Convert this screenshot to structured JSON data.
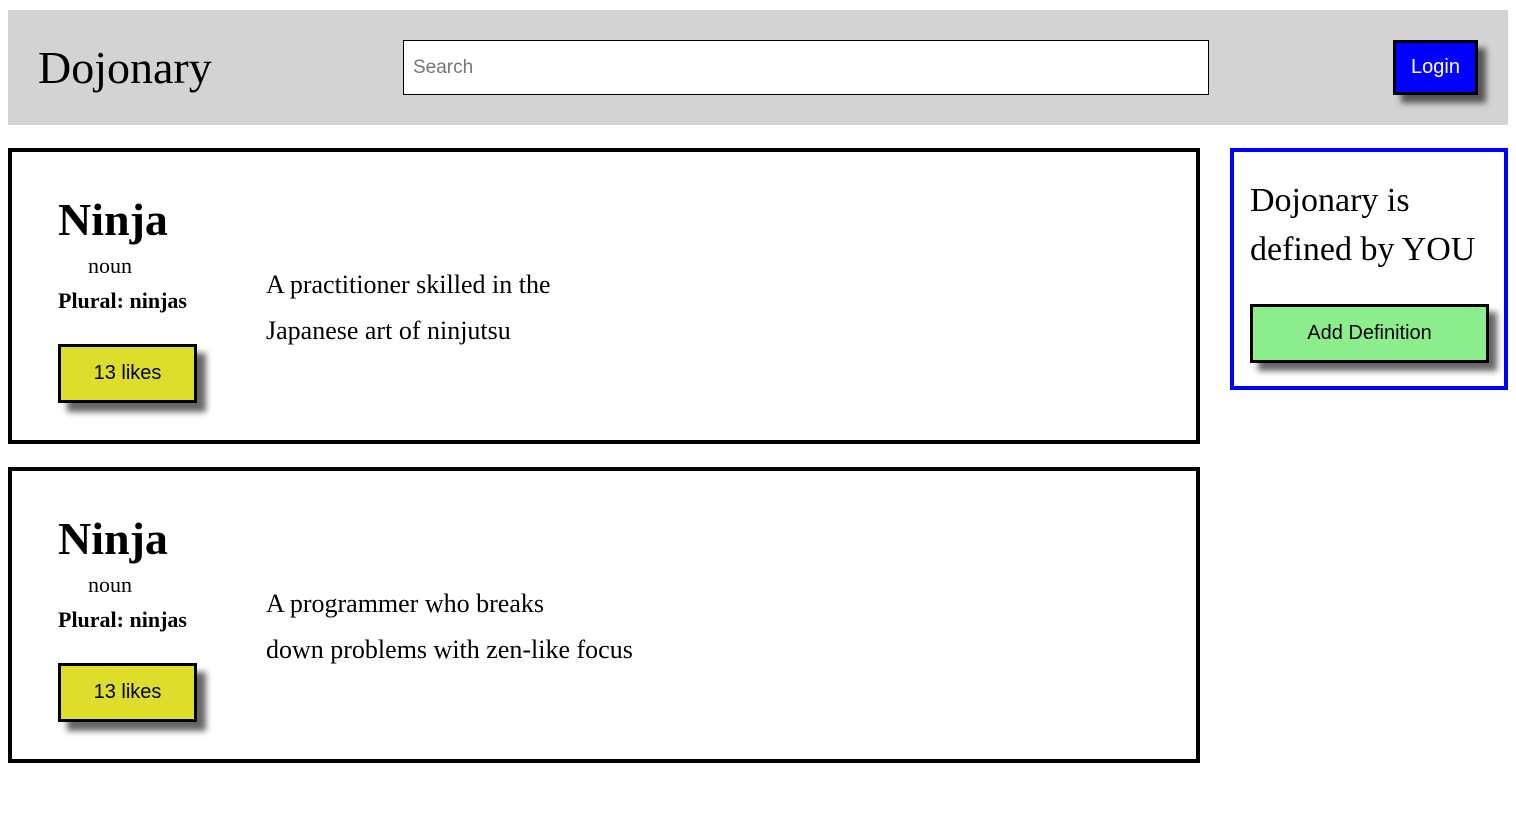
{
  "header": {
    "brand": "Dojonary",
    "search_placeholder": "Search",
    "login_label": "Login"
  },
  "entries": [
    {
      "word": "Ninja",
      "part_of_speech": "noun",
      "plural": "Plural: ninjas",
      "likes_label": "13 likes",
      "definition_line1": "A practitioner skilled in the",
      "definition_line2": "Japanese art of ninjutsu"
    },
    {
      "word": "Ninja",
      "part_of_speech": "noun",
      "plural": "Plural: ninjas",
      "likes_label": "13 likes",
      "definition_line1": "A programmer who breaks",
      "definition_line2": "down problems with zen-like focus"
    }
  ],
  "sidebar": {
    "tagline": "Dojonary is defined by YOU",
    "add_definition_label": "Add Definition"
  },
  "colors": {
    "header_bg": "#d3d3d3",
    "login_bg": "#0000ff",
    "likes_bg": "#dddd2b",
    "add_definition_bg": "#8ced8c",
    "sidebar_border": "#0000ff"
  }
}
